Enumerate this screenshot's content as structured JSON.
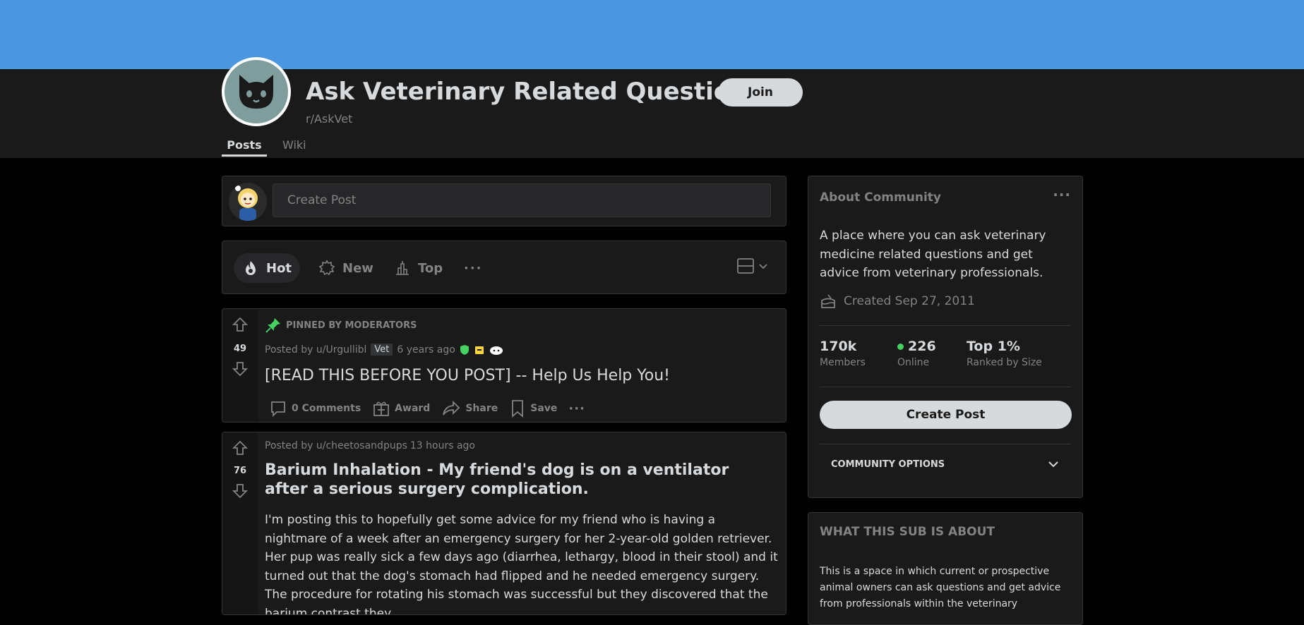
{
  "community": {
    "title": "Ask Veterinary Related Questions",
    "name": "r/AskVet",
    "join_label": "Join",
    "avatar_icon": "cat-face-icon",
    "banner_color": "#4a97e0",
    "avatar_color": "#7f9d9c"
  },
  "tabs": [
    {
      "label": "Posts",
      "active": true
    },
    {
      "label": "Wiki",
      "active": false
    }
  ],
  "create_post": {
    "placeholder": "Create Post"
  },
  "sort": {
    "hot": "Hot",
    "new": "New",
    "top": "Top",
    "more": "···"
  },
  "posts": [
    {
      "pinned_label": "PINNED BY MODERATORS",
      "votes": "49",
      "posted_by": "Posted by u/Urgullibl",
      "flair": "Vet",
      "age": "6 years ago",
      "title": "[READ THIS BEFORE YOU POST] -- Help Us Help You!",
      "comments": "0 Comments",
      "award": "Award",
      "share": "Share",
      "save": "Save",
      "more": "···"
    },
    {
      "votes": "76",
      "posted_by": "Posted by u/cheetosandpups",
      "age": "13 hours ago",
      "title": "Barium Inhalation - My friend's dog is on a ventilator after a serious surgery complication.",
      "body": "I'm posting this to hopefully get some advice for my friend who is having a nightmare of a week after an emergency surgery for her 2-year-old golden retriever. Her pup was really sick a few days ago (diarrhea, lethargy, blood in their stool) and it turned out that the dog's stomach had flipped and he needed emergency surgery. The procedure for rotating his stomach was successful but they discovered that the barium contrast they"
    }
  ],
  "about": {
    "heading": "About Community",
    "more": "···",
    "description": "A place where you can ask veterinary medicine related questions and get advice from veterinary professionals.",
    "created": "Created Sep 27, 2011",
    "members_value": "170k",
    "members_label": "Members",
    "online_value": "226",
    "online_label": "Online",
    "rank_value": "Top 1%",
    "rank_label": "Ranked by Size",
    "create_post_label": "Create Post",
    "community_options": "COMMUNITY OPTIONS"
  },
  "what_this_sub": {
    "heading": "WHAT THIS SUB IS ABOUT",
    "body": "This is a space in which current or prospective animal owners can ask questions and get advice from professionals within the veterinary"
  }
}
